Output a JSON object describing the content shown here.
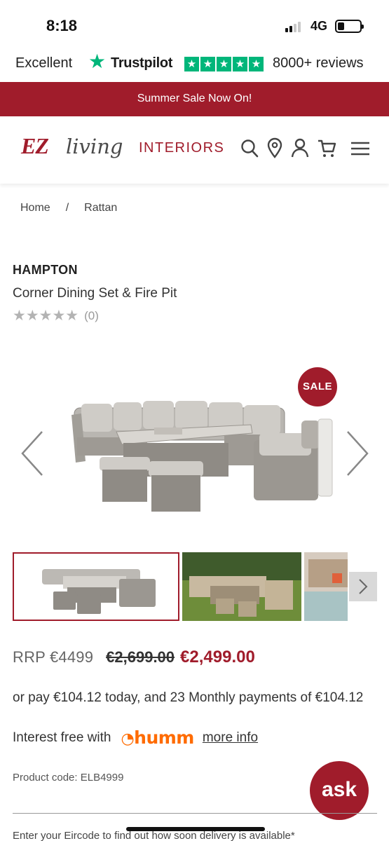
{
  "status_bar": {
    "time": "8:18",
    "network": "4G",
    "battery_level": 0.3
  },
  "trust_bar": {
    "rating_word": "Excellent",
    "brand": "Trustpilot",
    "stars": 5,
    "reviews": "8000+ reviews",
    "color": "#00b67a"
  },
  "promo": {
    "text": "Summer Sale Now On!",
    "color": "#a01c2b"
  },
  "header": {
    "logo": {
      "ez": "EZ",
      "living": "living",
      "interiors": "INTERIORS"
    },
    "icons": [
      "search-icon",
      "location-pin-icon",
      "account-icon",
      "cart-icon",
      "menu-icon"
    ]
  },
  "breadcrumb": {
    "items": [
      "Home",
      "Rattan"
    ],
    "separator": "/"
  },
  "product": {
    "brand": "HAMPTON",
    "name": "Corner Dining Set & Fire Pit",
    "stars_filled": 0,
    "stars_total": 5,
    "review_count": "(0)",
    "badge": "SALE",
    "rrp": "RRP €4499",
    "old_price": "€2,699.00",
    "price": "€2,499.00",
    "finance_text": "or pay €104.12 today, and 23 Monthly payments of €104.12",
    "interest_text": "Interest free with",
    "humm_logo": "humm",
    "more_info": "more info",
    "code": "Product code: ELB4999",
    "thumbnails_count": 3,
    "active_thumbnail": 1
  },
  "ask_button": {
    "label": "ask"
  },
  "eircode": {
    "text": "Enter your Eircode to find out how soon delivery is available*"
  }
}
